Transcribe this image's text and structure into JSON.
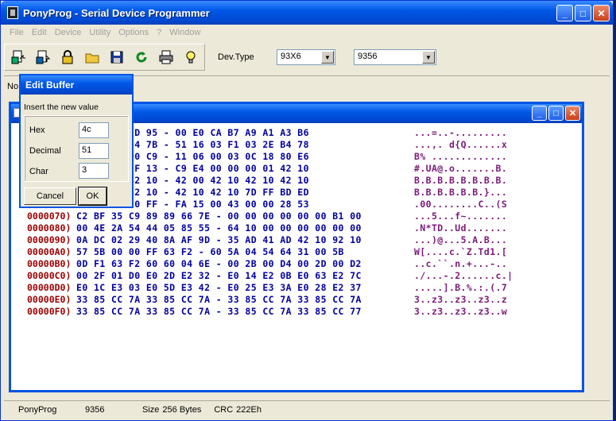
{
  "window": {
    "title": "PonyProg - Serial Device Programmer",
    "minimize": "_",
    "maximize": "□",
    "close": "✕"
  },
  "menu": [
    "File",
    "Edit",
    "Device",
    "Utility",
    "Options",
    "?",
    "Window"
  ],
  "toolbar": {
    "icons": [
      "open-device-icon",
      "save-device-icon",
      "lock-icon",
      "open-folder-icon",
      "save-disk-icon",
      "reload-icon",
      "print-icon",
      "hint-bulb-icon"
    ],
    "dev_type_label": "Dev.Type",
    "family_value": "93X6",
    "device_value": "9356"
  },
  "bg_strip_text": "No",
  "child_window": {
    "minimize": "_",
    "maximize": "□",
    "close": "✕"
  },
  "hex_rows": [
    {
      "addr": "",
      "bytes": "3D 02 C8 2D 95 - 00 E0 CA B7 A9 A1 A3 B6",
      "ascii": "...=..-........."
    },
    {
      "addr": "",
      "bytes": "2C 12 20 64 7B - 51 16 03 F1 03 2E B4 78",
      "ascii": "...,. d{Q......x"
    },
    {
      "addr": "",
      "bytes": "09 0C B1 D0 C9 - 11 06 00 03 0C 18 80 E6",
      "ascii": "B% ............."
    },
    {
      "addr": "",
      "bytes": "41 40 00 6F 13 - C9 E4 00 00 00 01 42 10",
      "ascii": "#.UA@.o.......B."
    },
    {
      "addr": "",
      "bytes": "02 42 10 42 10 - 42 00 42 10 42 10 42 10",
      "ascii": "B.B.B.B.B.B.B.B."
    },
    {
      "addr": "",
      "bytes": "10 42 10 42 10 - 42 10 42 10 7D FF BD ED",
      "ascii": "B.B.B.B.B.B.}..."
    },
    {
      "addr": "",
      "bytes": "FF 00 00 00 FF - FA 15 00 43 00 00 28 53",
      "ascii": ".00........C..(S"
    },
    {
      "addr": "0000070)",
      "bytes": "C2 BF 35 C9 89 89 66 7E - 00 00 00 00 00 00 B1 00",
      "ascii": "...5...f~......."
    },
    {
      "addr": "0000080)",
      "bytes": "00 4E 2A 54 44 05 85 55 - 64 10 00 00 00 00 00 00",
      "ascii": ".N*TD..Ud......."
    },
    {
      "addr": "0000090)",
      "bytes": "0A DC 02 29 40 8A AF 9D - 35 AD 41 AD 42 10 92 10",
      "ascii": "...)@...5.A.B..."
    },
    {
      "addr": "00000A0)",
      "bytes": "57 5B 00 00 FF 63 F2 - 60 5A 04 54 64 31 00 5B",
      "ascii": "W[....c.`Z.Td1.["
    },
    {
      "addr": "00000B0)",
      "bytes": "0D F1 63 F2 60 60 04 6E - 00 2B 00 D4 00 2D 00 D2",
      "ascii": "..c.``.n.+...-.."
    },
    {
      "addr": "00000C0)",
      "bytes": "00 2F 01 D0 E0 2D E2 32 - E0 14 E2 0B E0 63 E2 7C",
      "ascii": "./...-.2......c.|"
    },
    {
      "addr": "00000D0)",
      "bytes": "E0 1C E3 03 E0 5D E3 42 - E0 25 E3 3A E0 28 E2 37",
      "ascii": ".....].B.%.:.(.7"
    },
    {
      "addr": "00000E0)",
      "bytes": "33 85 CC 7A 33 85 CC 7A - 33 85 CC 7A 33 85 CC 7A",
      "ascii": "3..z3..z3..z3..z"
    },
    {
      "addr": "00000F0)",
      "bytes": "33 85 CC 7A 33 85 CC 7A - 33 85 CC 7A 33 85 CC 77",
      "ascii": "3..z3..z3..z3..w"
    }
  ],
  "status": {
    "app": "PonyProg",
    "device": "9356",
    "size_label": "Size",
    "size_value": "256 Bytes",
    "crc_label": "CRC",
    "crc_value": "222Eh"
  },
  "dialog": {
    "title": "Edit Buffer",
    "prompt": "Insert the new value",
    "hex_label": "Hex",
    "hex_value": "4c",
    "decimal_label": "Decimal",
    "decimal_value": "51",
    "char_label": "Char",
    "char_value": "3",
    "cancel": "Cancel",
    "ok": "OK"
  },
  "colors": {
    "address": "#9c0000",
    "bytes": "#0000a0",
    "ascii": "#7b1a7b",
    "titlebar": "#0058e6"
  }
}
